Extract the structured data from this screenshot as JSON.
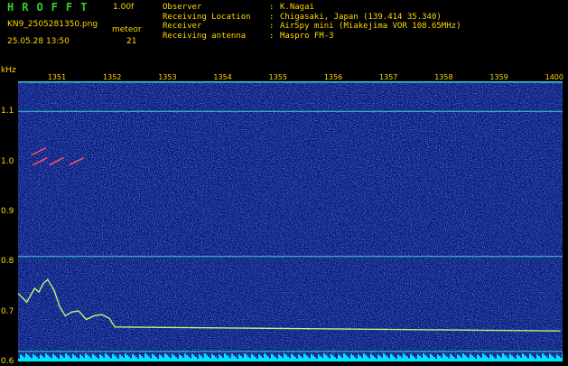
{
  "header": {
    "app_title": "HROFFT",
    "version": "1.00f",
    "filename": "KN9_2505281350.png",
    "datetime": "25.05.28 13:50",
    "meteor_label": "meteor",
    "meteor_count": "21"
  },
  "info": [
    {
      "label": "Observer",
      "sep": ":",
      "value": "K.Nagai"
    },
    {
      "label": "Receiving Location",
      "sep": ":",
      "value": "Chigasaki, Japan (139.414 35.340)"
    },
    {
      "label": "Receiver",
      "sep": ":",
      "value": "AirSpy mini (Miakejima VOR 108.65MHz)"
    },
    {
      "label": "Receiving antenna",
      "sep": ":",
      "value": "Maspro FM-3"
    }
  ],
  "chart_data": {
    "type": "heatmap",
    "ylabel": "kHz",
    "x_ticks": [
      "1351",
      "1352",
      "1353",
      "1354",
      "1355",
      "1356",
      "1357",
      "1358",
      "1359",
      "1400"
    ],
    "y_ticks": [
      "1.1",
      "1.0",
      "0.9",
      "0.8",
      "0.7",
      "0.6"
    ],
    "ylim": [
      0.6,
      1.16
    ],
    "xlim": [
      1350.7,
      1400.2
    ],
    "horizontal_lines_khz": [
      1.16,
      1.1,
      0.81,
      0.62
    ],
    "trace": {
      "x": [
        1350.7,
        1351.5,
        1352.2,
        1352.6,
        1353.0,
        1353.4,
        1354.0,
        1354.5,
        1355.0,
        1355.6,
        1356.2,
        1356.9,
        1357.6,
        1358.3,
        1359.0,
        1359.5,
        1400.0
      ],
      "y": [
        0.735,
        0.72,
        0.745,
        0.74,
        0.755,
        0.765,
        0.74,
        0.71,
        0.69,
        0.7,
        0.7,
        0.685,
        0.69,
        0.695,
        0.685,
        0.67,
        0.66
      ]
    },
    "meteor_echoes": [
      {
        "x": 1352.7,
        "y": 1.0
      },
      {
        "x": 1352.6,
        "y": 1.02
      },
      {
        "x": 1354.2,
        "y": 1.0
      },
      {
        "x": 1356.0,
        "y": 1.0
      }
    ],
    "colors": {
      "background": "#0a1a7a",
      "noise": "#2a5cff",
      "lines": "#3ad6d6",
      "trace": "#c8f07a",
      "bottom_noise": "#00e5ff",
      "echo": "#ff4d7a"
    }
  }
}
